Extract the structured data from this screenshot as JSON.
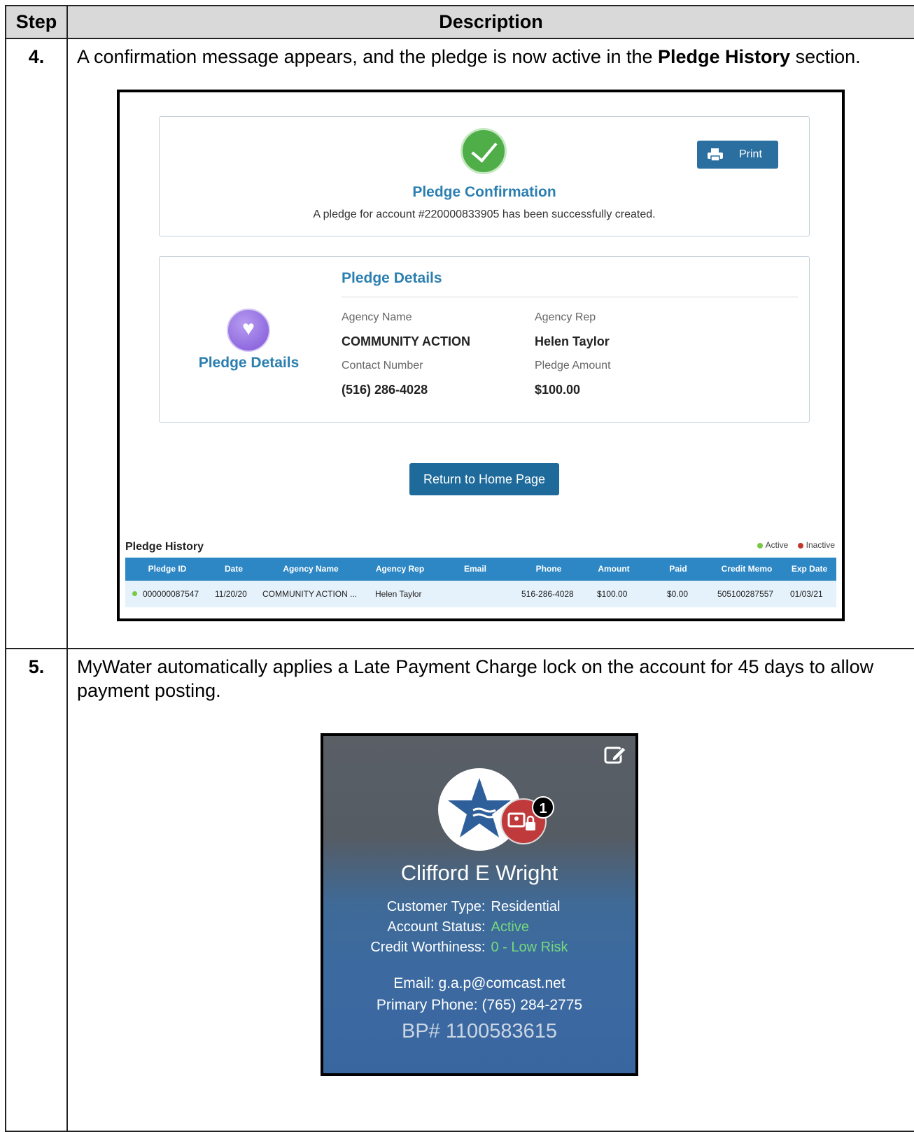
{
  "table": {
    "header_step": "Step",
    "header_description": "Description"
  },
  "step4": {
    "number": "4.",
    "text_before": "A confirmation message appears, and the pledge is now active in the ",
    "text_bold": "Pledge History",
    "text_after": " section.",
    "confirmation": {
      "title": "Pledge Confirmation",
      "message": "A pledge for account #220000833905 has been successfully created.",
      "print_label": "Print"
    },
    "details": {
      "side_label": "Pledge Details",
      "heading": "Pledge Details",
      "agency_name_label": "Agency Name",
      "agency_name_value": "COMMUNITY ACTION",
      "agency_rep_label": "Agency Rep",
      "agency_rep_value": "Helen Taylor",
      "contact_label": "Contact Number",
      "contact_value": "(516) 286-4028",
      "amount_label": "Pledge Amount",
      "amount_value": "$100.00"
    },
    "return_label": "Return to Home Page",
    "history": {
      "title": "Pledge History",
      "legend_active": "Active",
      "legend_inactive": "Inactive",
      "legend_active_color": "#79c843",
      "legend_inactive_color": "#c0392b",
      "columns": [
        "Pledge ID",
        "Date",
        "Agency Name",
        "Agency Rep",
        "Email",
        "Phone",
        "Amount",
        "Paid",
        "Credit Memo",
        "Exp Date"
      ],
      "row": {
        "pledge_id": "000000087547",
        "date": "11/20/20",
        "agency_name": "COMMUNITY ACTION ...",
        "agency_rep": "Helen Taylor",
        "email": "",
        "phone": "516-286-4028",
        "amount": "$100.00",
        "paid": "$0.00",
        "credit_memo": "505100287557",
        "exp_date": "01/03/21"
      }
    }
  },
  "step5": {
    "number": "5.",
    "text": "MyWater automatically applies a Late Payment Charge lock on the account for 45 days to allow payment posting.",
    "card": {
      "badge_count": "1",
      "name": "Clifford E Wright",
      "customer_type_label": "Customer Type:",
      "customer_type_value": "Residential",
      "account_status_label": "Account Status:",
      "account_status_value": "Active",
      "credit_label": "Credit Worthiness:",
      "credit_value": "0 - Low Risk",
      "email": "Email: g.a.p@comcast.net",
      "phone": "Primary Phone: (765) 284-2775",
      "bp": "BP# 1100583615"
    }
  },
  "colors": {
    "accent_blue": "#2b7fb0",
    "button_blue": "#1e6a9a",
    "success_green": "#4fae47",
    "table_header_blue": "#2d87c4"
  }
}
